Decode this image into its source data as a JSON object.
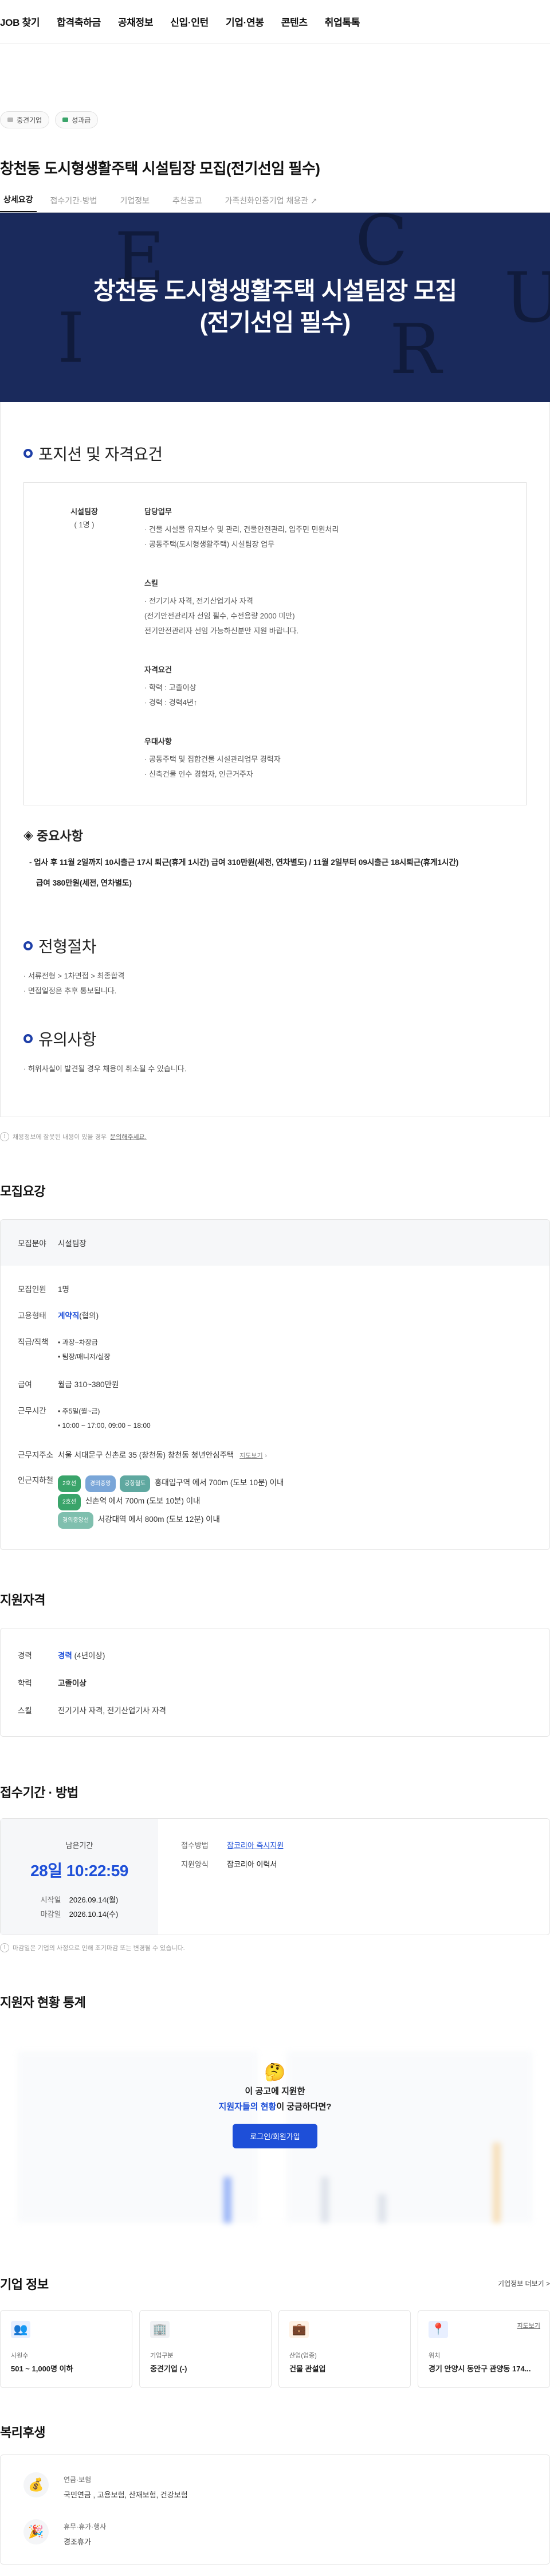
{
  "nav": [
    "JOB 찾기",
    "합격축하금",
    "공채정보",
    "신입·인턴",
    "기업·연봉",
    "콘텐츠",
    "취업톡톡"
  ],
  "chips": [
    {
      "label": "중견기업",
      "color": "#b8b8b8"
    },
    {
      "label": "성과급",
      "color": "#3aa46a"
    }
  ],
  "job_title": "창천동 도시형생활주택 시설팀장 모집(전기선임 필수)",
  "tabs": [
    "상세요강",
    "접수기간·방법",
    "기업정보",
    "추천공고",
    "가족친화인증기업 채용관"
  ],
  "banner": {
    "line1": "창천동 도시형생활주택 시설팀장 모집",
    "line2": "(전기선임 필수)"
  },
  "position": {
    "heading": "포지션 및 자격요건",
    "role": "시설팀장",
    "count": "( 1명 )",
    "blocks": [
      {
        "title": "담당업무",
        "items": [
          "· 건물 시설물 유지보수 및 관리, 건물안전관리, 입주민 민원처리",
          "· 공동주택(도시형생활주택) 시설팀장 업무"
        ]
      },
      {
        "title": "스킬",
        "items": [
          "· 전기기사 자격, 전기산업기사 자격",
          "(전기안전관리자 선임 필수, 수전용량 2000 미만)",
          "전기안전관리자 선임 가능하신분만 지원 바랍니다."
        ]
      },
      {
        "title": "자격요건",
        "items": [
          "· 학력 : 고졸이상",
          "· 경력 : 경력4년↑"
        ]
      },
      {
        "title": "우대사항",
        "items": [
          "· 공동주택 및 집합건물 시설관리업무 경력자",
          "· 신축건물 인수 경험자, 인근거주자"
        ]
      }
    ]
  },
  "important": {
    "heading": "중요사항",
    "line1": "- 업사 후 11월 2일까지 10시출근 17시 퇴근(휴게 1시간) 급여 310만원(세전, 연차별도) / 11월 2일부터 09시출근 18시퇴근(휴게1시간)",
    "line2": "급여 380만원(세전, 연차별도)"
  },
  "process": {
    "heading": "전형절차",
    "items": [
      "· 서류전형 > 1차면접 > 최종합격",
      "· 면접일정은 추후 통보됩니다."
    ]
  },
  "caution": {
    "heading": "유의사항",
    "items": [
      "· 허위사실이 발견될 경우 채용이 취소될 수 있습니다."
    ]
  },
  "report_note": {
    "text": "채용정보에 잘못된 내용이 있을 경우",
    "link": "문의해주세요."
  },
  "recruit": {
    "heading": "모집요강",
    "field_label": "모집분야",
    "field_value": "시설팀장",
    "count_label": "모집인원",
    "count_value": "1명",
    "type_label": "고용형태",
    "type_value": "계약직",
    "type_sub": "(협의)",
    "position_label": "직급/직책",
    "position_items": [
      "• 과장~차장급",
      "• 팀장/매니저/실장"
    ],
    "salary_label": "급여",
    "salary_value": "월급 310~380만원",
    "hours_label": "근무시간",
    "hours_items": [
      "• 주5일(월~금)",
      "• 10:00 ~ 17:00, 09:00 ~ 18:00"
    ],
    "addr_label": "근무지주소",
    "addr_value": "서울 서대문구 신촌로 35 (창천동) 창천동 청년안심주택",
    "addr_link": "지도보기",
    "station_label": "인근지하철",
    "stations": [
      {
        "tags": [
          {
            "t": "2호선",
            "c": "#3aa46a"
          },
          {
            "t": "경의중앙",
            "c": "#7aa6d8"
          },
          {
            "t": "공항철도",
            "c": "#5fa8a0"
          }
        ],
        "text": "홍대입구역 에서 700m (도보 10분) 이내"
      },
      {
        "tags": [
          {
            "t": "2호선",
            "c": "#3aa46a"
          }
        ],
        "text": "신촌역 에서 700m (도보 10분) 이내"
      },
      {
        "tags": [
          {
            "t": "경의중앙선",
            "c": "#7fbfae"
          }
        ],
        "text": "서강대역 에서 800m (도보 12분) 이내"
      }
    ]
  },
  "qualify": {
    "heading": "지원자격",
    "exp_label": "경력",
    "exp_value": "경력",
    "exp_sub": "(4년이상)",
    "edu_label": "학력",
    "edu_value": "고졸이상",
    "skill_label": "스킬",
    "skill_value": "전기기사 자격, 전기산업기사 자격"
  },
  "apply": {
    "heading": "접수기간 · 방법",
    "remain_label": "남은기간",
    "remain_value": "28일 10:22:59",
    "start_label": "시작일",
    "start_value": "2026.09.14(월)",
    "end_label": "마감일",
    "end_value": "2026.10.14(수)",
    "method_label": "접수방법",
    "method_value": "잡코리아 즉시지원",
    "form_label": "지원양식",
    "form_value": "잡코리아 이력서",
    "note": "마감일은 기업의 사정으로 인해 조기마감 또는 변경될 수 있습니다."
  },
  "stats": {
    "heading": "지원자 현황 통계",
    "q1": "이 공고에 지원한",
    "q2_em": "지원자들의 현황",
    "q2_rest": "이 궁금하다면?",
    "btn": "로그인/회원가입"
  },
  "company": {
    "heading": "기업 정보",
    "more": "기업정보 더보기 >",
    "cards": [
      {
        "icon": "👥",
        "bg": "#e8efff",
        "label": "사원수",
        "value": "501 ~ 1,000명 이하"
      },
      {
        "icon": "🏢",
        "bg": "#f0f1f4",
        "label": "기업구분",
        "value": "중견기업 (-)"
      },
      {
        "icon": "💼",
        "bg": "#fff1e4",
        "label": "산업(업종)",
        "value": "건물 관설업"
      },
      {
        "icon": "📍",
        "bg": "#e8efff",
        "label": "위치",
        "value": "경기 안양시 동안구 관양동 174...",
        "map": "지도보기"
      }
    ]
  },
  "welfare": {
    "heading": "복리후생",
    "items": [
      {
        "icon": "💰",
        "title": "연금·보험",
        "value": "국민연금 , 고용보험, 산재보험, 건강보험"
      },
      {
        "icon": "🎉",
        "title": "휴무·휴가·행사",
        "value": "경조휴가"
      }
    ]
  }
}
